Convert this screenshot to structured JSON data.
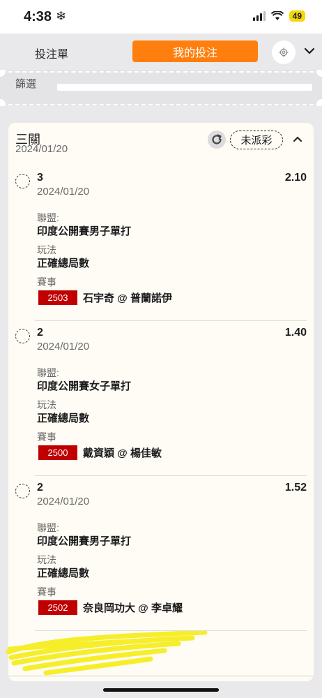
{
  "status_bar": {
    "time": "4:38",
    "weather_icon": "snowflake-icon",
    "battery": "49"
  },
  "tabs": {
    "slip": "投注單",
    "my_bets": "我的投注"
  },
  "filter": {
    "label": "篩選"
  },
  "bet": {
    "type": "三關",
    "date": "2024/01/20",
    "status": "未派彩",
    "legs": [
      {
        "selection": "3",
        "date": "2024/01/20",
        "odds": "2.10",
        "league_label": "聯盟:",
        "league": "印度公開賽男子單打",
        "market_label": "玩法",
        "market": "正確總局數",
        "match_label": "賽事",
        "match_id": "2503",
        "match": "石宇奇 @ 普蘭諾伊"
      },
      {
        "selection": "2",
        "date": "2024/01/20",
        "odds": "1.40",
        "league_label": "聯盟:",
        "league": "印度公開賽女子單打",
        "market_label": "玩法",
        "market": "正確總局數",
        "match_label": "賽事",
        "match_id": "2500",
        "match": "戴資穎 @ 楊佳敏"
      },
      {
        "selection": "2",
        "date": "2024/01/20",
        "odds": "1.52",
        "league_label": "聯盟:",
        "league": "印度公開賽男子單打",
        "market_label": "玩法",
        "market": "正確總局數",
        "match_label": "賽事",
        "match_id": "2502",
        "match": "奈良岡功大 @ 李卓耀"
      }
    ]
  },
  "colors": {
    "accent": "#ff7f0e",
    "badge": "#c00000",
    "card_bg": "#fefcf4",
    "highlight_scribble": "#f6ee2a"
  }
}
